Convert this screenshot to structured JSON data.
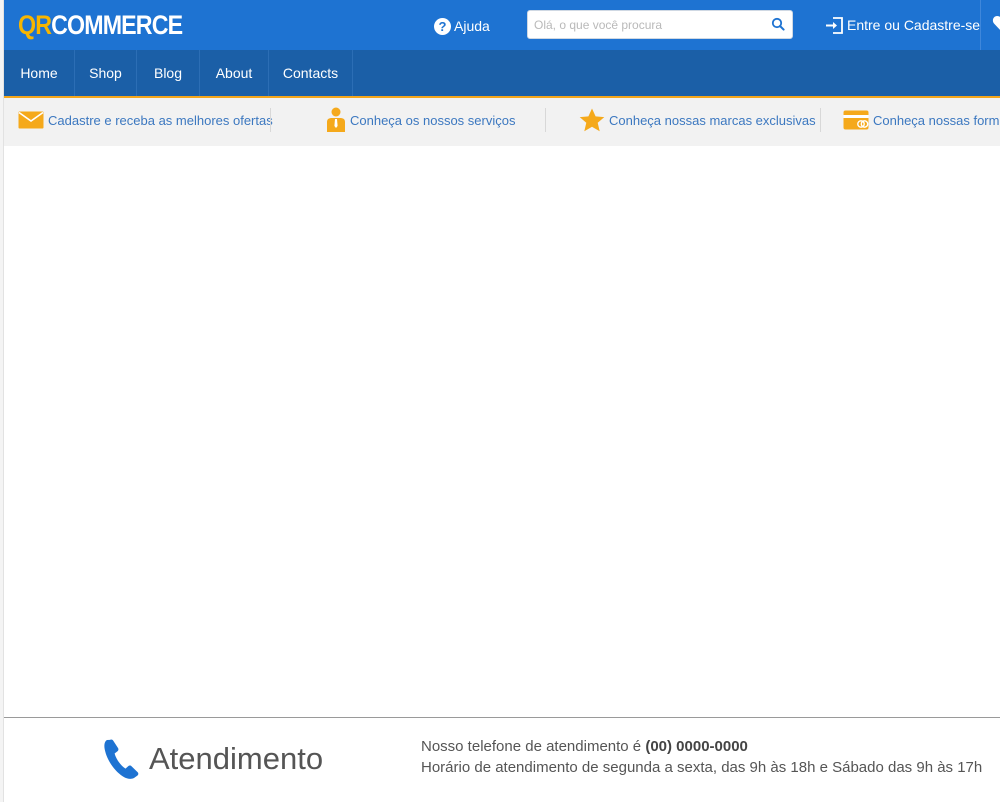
{
  "header": {
    "logo_qr": "QR",
    "logo_commerce": "COMMERCE",
    "help_label": "Ajuda",
    "search_placeholder": "Olá, o que você procura",
    "login_label": "Entre ou Cadastre-se"
  },
  "nav": {
    "items": [
      {
        "label": "Home"
      },
      {
        "label": "Shop"
      },
      {
        "label": "Blog"
      },
      {
        "label": "About"
      },
      {
        "label": "Contacts"
      }
    ]
  },
  "benefits": {
    "items": [
      {
        "label": "Cadastre e receba as melhores ofertas",
        "icon": "envelope-icon"
      },
      {
        "label": "Conheça os nossos serviços",
        "icon": "person-icon"
      },
      {
        "label": "Conheça nossas marcas exclusivas",
        "icon": "star-icon"
      },
      {
        "label": "Conheça nossas forma",
        "icon": "card-icon"
      }
    ]
  },
  "footer": {
    "attend_title": "Atendimento",
    "phone_prefix": "Nosso telefone de atendimento é ",
    "phone_number": "(00) 0000-0000",
    "hours": "Horário de atendimento de segunda a sexta, das 9h às 18h e Sábado das 9h às 17h"
  },
  "colors": {
    "topbar": "#1e73d2",
    "navbar": "#1b5fa7",
    "accent": "#f7b500",
    "link": "#3c78c0"
  }
}
